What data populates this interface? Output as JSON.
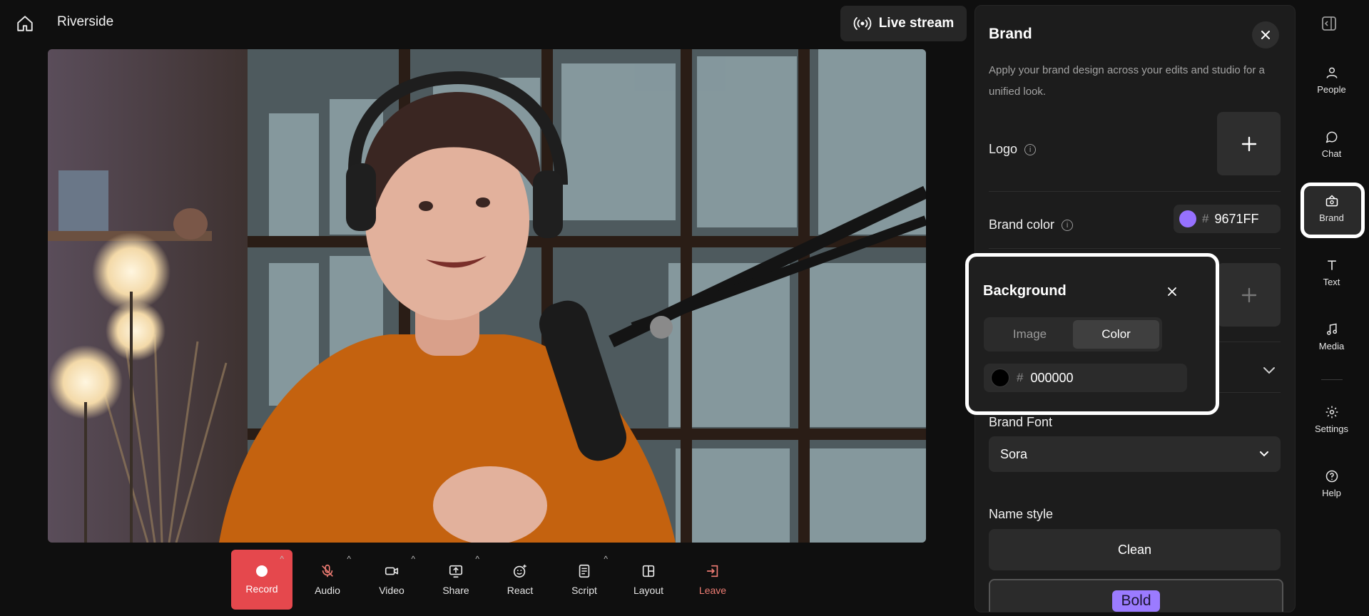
{
  "app": {
    "title": "Riverside"
  },
  "header": {
    "live_stream_label": "Live stream"
  },
  "controls": [
    {
      "key": "record",
      "label": "Record",
      "icon": "record-dot-icon"
    },
    {
      "key": "audio",
      "label": "Audio",
      "icon": "mic-muted-icon"
    },
    {
      "key": "video",
      "label": "Video",
      "icon": "camera-icon"
    },
    {
      "key": "share",
      "label": "Share",
      "icon": "screen-share-icon"
    },
    {
      "key": "react",
      "label": "React",
      "icon": "emoji-icon"
    },
    {
      "key": "script",
      "label": "Script",
      "icon": "script-icon"
    },
    {
      "key": "layout",
      "label": "Layout",
      "icon": "layout-icon"
    },
    {
      "key": "leave",
      "label": "Leave",
      "icon": "leave-icon"
    }
  ],
  "brand_panel": {
    "title": "Brand",
    "description": "Apply your brand design across your edits and studio for a unified look.",
    "logo_label": "Logo",
    "brand_color_label": "Brand color",
    "brand_color_value": "9671FF",
    "brand_color_hex": "#9671FF",
    "brand_font_label": "Brand Font",
    "brand_font_value": "Sora",
    "name_style_label": "Name style",
    "name_styles": [
      "Clean",
      "Bold"
    ]
  },
  "background_popover": {
    "title": "Background",
    "tabs": [
      "Image",
      "Color"
    ],
    "active_tab": "Color",
    "color_value": "000000",
    "color_hex": "#000000"
  },
  "rail": {
    "items": [
      {
        "label": "People",
        "icon": "people-icon"
      },
      {
        "label": "Chat",
        "icon": "chat-icon"
      },
      {
        "label": "Brand",
        "icon": "brand-icon",
        "active": true
      },
      {
        "label": "Text",
        "icon": "text-icon"
      },
      {
        "label": "Media",
        "icon": "music-note-icon"
      },
      {
        "label": "Settings",
        "icon": "gear-icon"
      },
      {
        "label": "Help",
        "icon": "help-icon"
      }
    ]
  }
}
